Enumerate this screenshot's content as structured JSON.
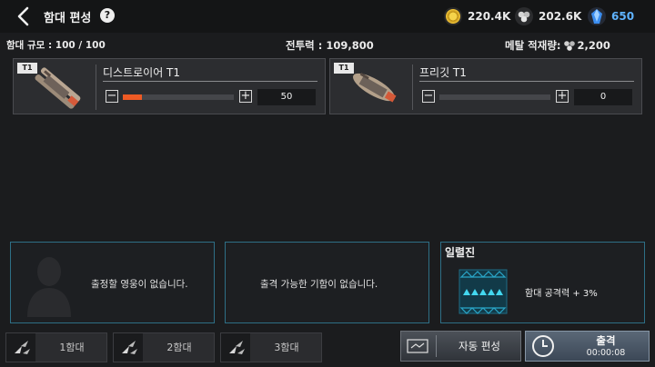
{
  "header": {
    "title": "함대 편성",
    "help_label": "?",
    "resources": {
      "gold": "220.4K",
      "metal": "202.6K",
      "gem": "650"
    }
  },
  "stats": {
    "fleet_size": "함대 규모 : 100 / 100",
    "combat_power": "전투력 : 109,800",
    "metal_load_label": "메탈 적재량:",
    "metal_load_value": "2,200"
  },
  "ships": [
    {
      "tier": "T1",
      "name": "디스트로이어 T1",
      "count": "50",
      "minus": "−",
      "plus": "+",
      "fill_fraction": 0.17
    },
    {
      "tier": "T1",
      "name": "프리깃 T1",
      "count": "0",
      "minus": "−",
      "plus": "+",
      "fill_fraction": 0
    }
  ],
  "panels": {
    "hero_message": "출정할 영웅이 없습니다.",
    "sortie_message": "출격 가능한 기함이 없습니다.",
    "formation_title": "일렬진",
    "formation_effect": "함대 공격력 + 3%"
  },
  "fleet_tabs": [
    "1함대",
    "2함대",
    "3함대"
  ],
  "buttons": {
    "auto_formation": "자동 편성",
    "sortie": "출격",
    "sortie_timer": "00:00:08"
  },
  "colors": {
    "accent_orange": "#ee5a24",
    "panel_border": "#2e6f86",
    "gem_blue": "#5fb3ff"
  }
}
